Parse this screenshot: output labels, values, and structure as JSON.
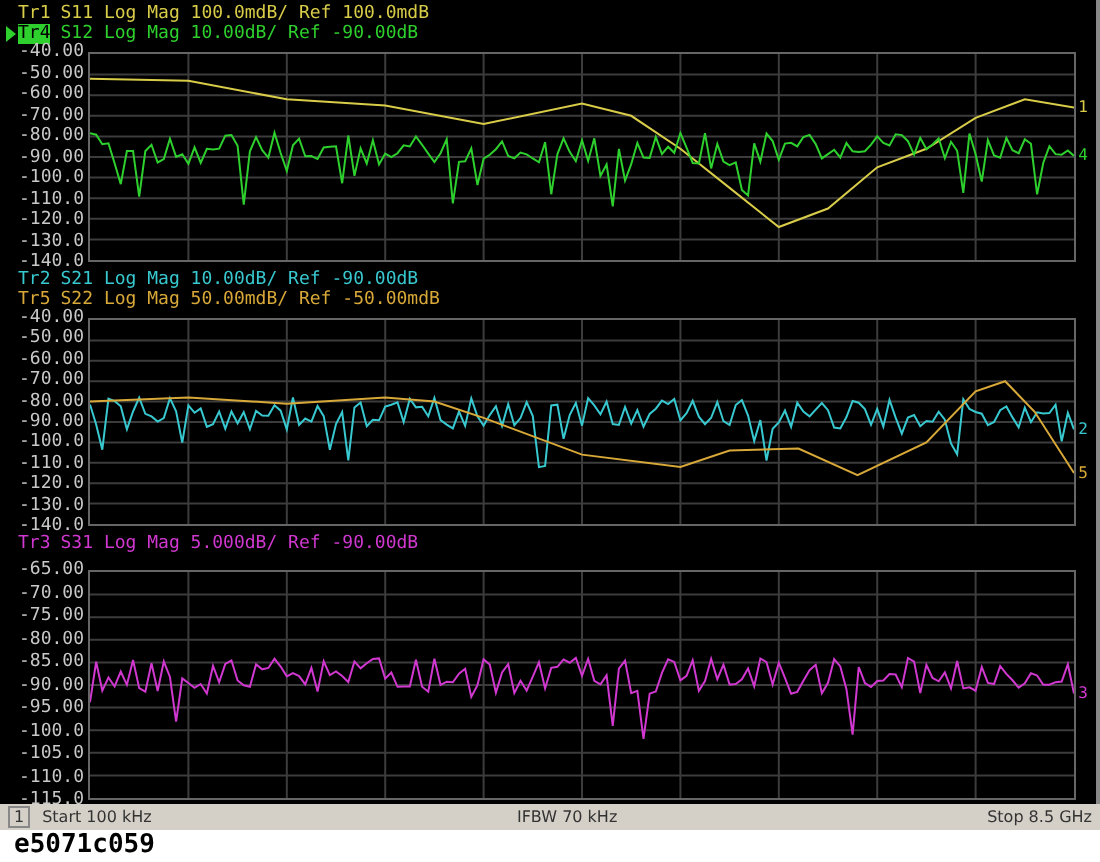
{
  "panels": [
    {
      "traces": [
        {
          "id": "Tr1",
          "title": "S11 Log Mag 100.0mdB/ Ref 100.0mdB",
          "color": "#d8cc48",
          "selected": false,
          "kind": "smooth",
          "end_label": "1"
        },
        {
          "id": "Tr4",
          "title": "S12 Log Mag 10.00dB/ Ref -90.00dB",
          "color": "#2ed02e",
          "selected": true,
          "kind": "noisy",
          "end_label": "4"
        }
      ],
      "scale": [
        "-40.00",
        "-50.00",
        "-60.00",
        "-70.00",
        "-80.00",
        "-90.00",
        "-100.0",
        "-110.0",
        "-120.0",
        "-130.0",
        "-140.0"
      ]
    },
    {
      "traces": [
        {
          "id": "Tr2",
          "title": "S21 Log Mag 10.00dB/ Ref -90.00dB",
          "color": "#38c8d0",
          "selected": false,
          "kind": "noisy",
          "end_label": "2"
        },
        {
          "id": "Tr5",
          "title": "S22 Log Mag 50.00mdB/ Ref -50.00mdB",
          "color": "#d8a838",
          "selected": false,
          "kind": "smooth",
          "end_label": "5"
        }
      ],
      "scale": [
        "-40.00",
        "-50.00",
        "-60.00",
        "-70.00",
        "-80.00",
        "-90.00",
        "-100.0",
        "-110.0",
        "-120.0",
        "-130.0",
        "-140.0"
      ]
    },
    {
      "traces": [
        {
          "id": "Tr3",
          "title": "S31 Log Mag 5.000dB/ Ref -90.00dB",
          "color": "#d038d0",
          "selected": false,
          "kind": "noisy",
          "end_label": "3"
        }
      ],
      "scale": [
        "-65.00",
        "-70.00",
        "-75.00",
        "-80.00",
        "-85.00",
        "-90.00",
        "-95.00",
        "-100.0",
        "-105.0",
        "-110.0",
        "-115.0"
      ]
    }
  ],
  "status_bar": {
    "channel": "1",
    "start": "Start 100 kHz",
    "ifbw": "IFBW 70 kHz",
    "stop": "Stop 8.5 GHz"
  },
  "caption": "e5071c059"
}
